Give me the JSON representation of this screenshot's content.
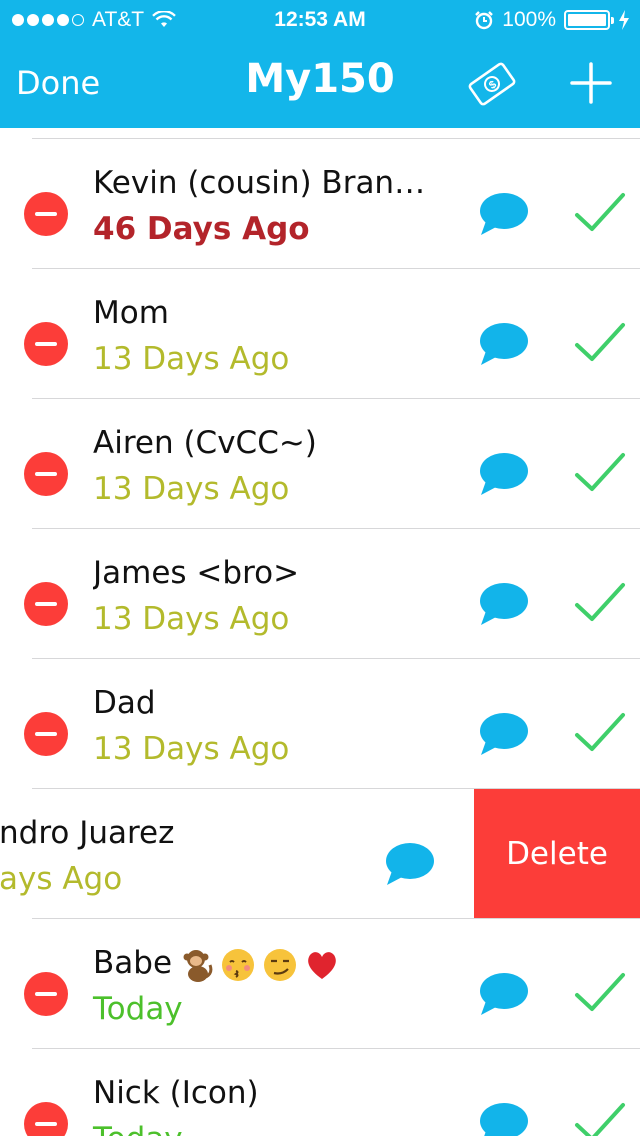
{
  "status_bar": {
    "carrier": "AT&T",
    "time": "12:53 AM",
    "battery": "100%"
  },
  "nav": {
    "done_label": "Done",
    "title": "My150"
  },
  "colors": {
    "header_bg": "#13b6ea",
    "overdue_red": "#b3242a",
    "warn_olive": "#b3ba2c",
    "ok_green": "#4cc02b",
    "bubble_blue": "#12b4ea",
    "check_green": "#3fcf6a",
    "delete_red": "#fc3d39"
  },
  "contacts": [
    {
      "name": "Kevin (cousin) Branni…",
      "last": "46 Days Ago",
      "status": "overdue"
    },
    {
      "name": "Mom",
      "last": "13 Days Ago",
      "status": "warn"
    },
    {
      "name": "Airen (CvCC~)",
      "last": "13 Days Ago",
      "status": "warn"
    },
    {
      "name": "James <bro>",
      "last": "13 Days Ago",
      "status": "warn"
    },
    {
      "name": "Dad",
      "last": "13 Days Ago",
      "status": "warn"
    },
    {
      "name": "ndro Juarez",
      "last": "ays Ago",
      "status": "warn",
      "swiped": true
    },
    {
      "name": "Babe",
      "last": "Today",
      "status": "ok",
      "emojis": [
        "monkey-icon",
        "kissing-face-icon",
        "smirking-face-icon",
        "red-heart-icon"
      ]
    },
    {
      "name": "Nick (Icon)",
      "last": "Today",
      "status": "ok"
    }
  ],
  "delete_label": "Delete"
}
